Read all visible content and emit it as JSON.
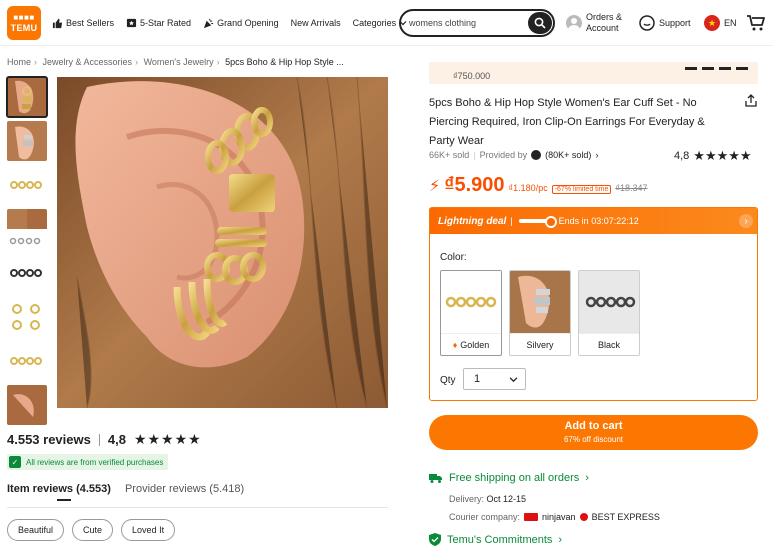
{
  "header": {
    "logo_line1": "■■■■",
    "logo_line2": "TEMU",
    "nav": [
      {
        "label": "Best Sellers",
        "icon": "thumbs-up-icon"
      },
      {
        "label": "5-Star Rated",
        "icon": "star-box-icon"
      },
      {
        "label": "Grand Opening",
        "icon": "party-icon"
      },
      {
        "label": "New Arrivals",
        "icon": ""
      },
      {
        "label": "Categories",
        "icon": "chevron-down-icon"
      }
    ],
    "search_value": "womens clothing",
    "orders_line1": "Orders &",
    "orders_line2": "Account",
    "support": "Support",
    "lang": "EN"
  },
  "breadcrumb": [
    "Home",
    "Jewelry & Accessories",
    "Women's Jewelry",
    "5pcs Boho & Hip Hop Style ..."
  ],
  "reviews": {
    "count_label": "4.553 reviews",
    "rating": "4,8",
    "stars": "★★★★★",
    "verified": "All reviews are from verified purchases",
    "tab_item": "Item reviews (4.553)",
    "tab_provider": "Provider reviews (5.418)",
    "chips": [
      "Beautiful",
      "Cute",
      "Loved It"
    ]
  },
  "product": {
    "prev_price": "₫750.000",
    "title": "5pcs Boho & Hip Hop Style Women's Ear Cuff Set - No Piercing Required, Iron Clip-On Earrings For Everyday & Party Wear",
    "sold": "66K+ sold",
    "provided_by": "Provided by",
    "provider_sold": "(80K+ sold)",
    "rating": "4,8",
    "stars": "★★★★★",
    "price": "₫5.900",
    "unit_price": "₫1.180/pc",
    "discount_badge": "-67% limited time",
    "old_price": "₫18.347"
  },
  "deal": {
    "label": "Lightning deal",
    "ends": "Ends in 03:07:22:12",
    "color_label": "Color:",
    "colors": [
      "Golden",
      "Silvery",
      "Black"
    ],
    "qty_label": "Qty",
    "qty_value": "1"
  },
  "cart": {
    "label": "Add to cart",
    "sub": "67% off discount"
  },
  "shipping": {
    "free": "Free shipping on all orders",
    "delivery_label": "Delivery:",
    "delivery_value": "Oct 12-15",
    "courier_label": "Courier company:",
    "courier1": "ninjavan",
    "courier2": "BEST EXPRESS",
    "commit": "Temu's Commitments"
  },
  "colors": {
    "accent": "#fb7701",
    "price": "#fb4e01",
    "green": "#0a8a3a"
  }
}
